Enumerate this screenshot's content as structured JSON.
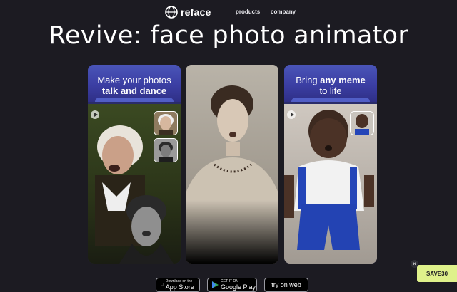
{
  "header": {
    "brand": "reface",
    "nav": [
      {
        "label": "products"
      },
      {
        "label": "company"
      }
    ]
  },
  "hero": {
    "title": "Revive: face photo animator"
  },
  "cards": [
    {
      "line1": "Make your photos",
      "line2": "talk and dance"
    },
    {},
    {
      "line1_prefix": "Bring ",
      "line1_bold": "any meme",
      "line2": "to life"
    }
  ],
  "store_buttons": [
    {
      "small": "Download on the",
      "big": "App Store",
      "icon": "apple-icon"
    },
    {
      "small": "GET IT ON",
      "big": "Google Play",
      "icon": "google-play-icon"
    },
    {
      "big": "try on web"
    }
  ],
  "promo": {
    "code": "SAVE30",
    "close": "×"
  },
  "colors": {
    "background": "#1c1b22",
    "card_blue": "#3b3ea3",
    "promo": "#dff18b"
  }
}
